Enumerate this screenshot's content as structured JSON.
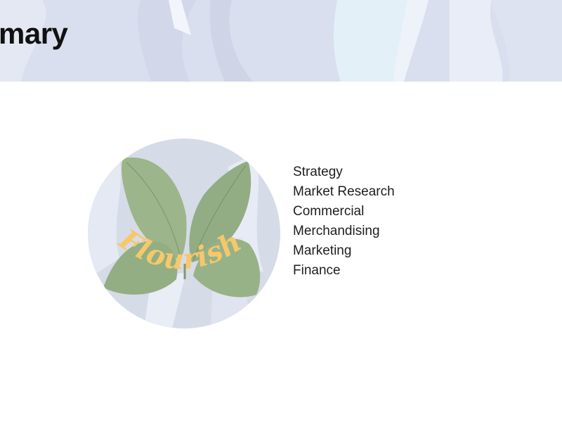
{
  "header": {
    "title": "mary",
    "background_color": "#d9dfee"
  },
  "logo": {
    "brand_text": "Flourish",
    "leaf_color": "#9cb58a",
    "text_color": "#f6c86a",
    "circle_color": "#d6dbe8"
  },
  "functions": [
    {
      "label": "Strategy"
    },
    {
      "label": "Market Research"
    },
    {
      "label": "Commercial"
    },
    {
      "label": "Merchandising"
    },
    {
      "label": "Marketing"
    },
    {
      "label": "Finance"
    }
  ]
}
